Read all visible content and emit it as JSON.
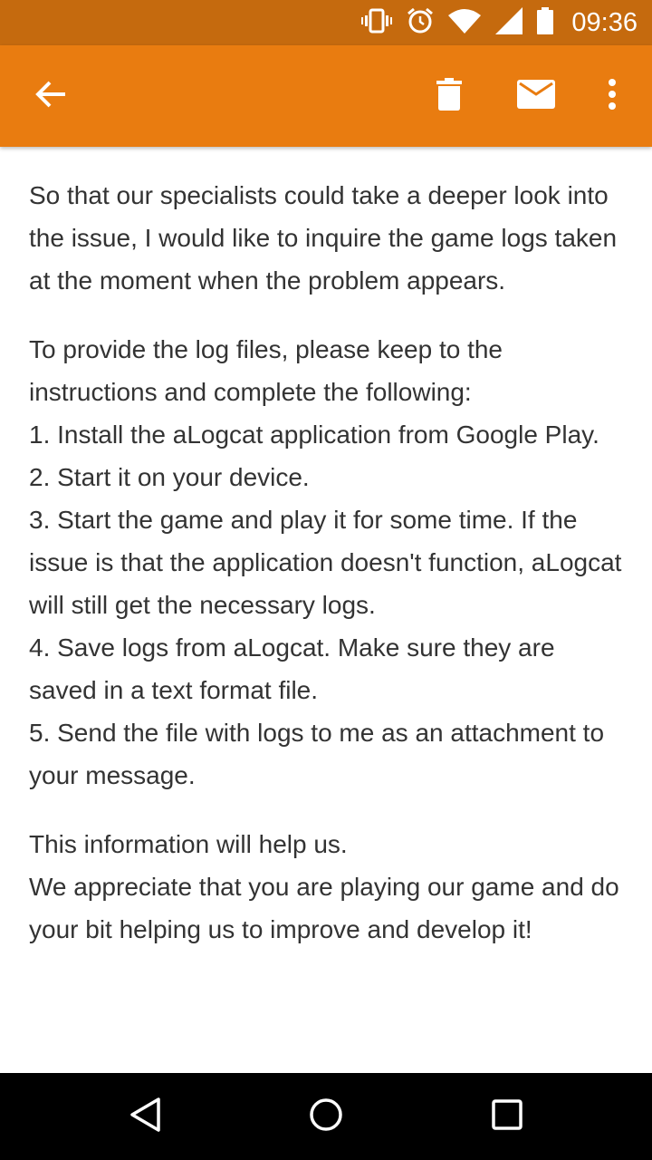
{
  "status_bar": {
    "time": "09:36",
    "icons": [
      "vibrate-icon",
      "alarm-icon",
      "wifi-icon",
      "signal-icon",
      "battery-icon"
    ]
  },
  "app_bar": {
    "background_color": "#e97c10",
    "actions": [
      "back-arrow-icon",
      "delete-icon",
      "mail-icon",
      "more-vert-icon"
    ]
  },
  "message": {
    "paragraphs": [
      {
        "lines": [
          "So that our specialists could take a deeper look into the issue, I would like to inquire the game logs taken at the moment when the problem appears."
        ]
      },
      {
        "lines": [
          "To provide the log files, please keep to the instructions and complete the following:",
          "1. Install the aLogcat application from Google Play.",
          "2. Start it on your device.",
          "3. Start the game and play it for some time. If the issue is that the application doesn't function, aLogcat will still get the necessary logs.",
          "4. Save logs from aLogcat. Make sure they are saved in a text format file.",
          "5. Send the file with logs to me as an attachment to your message."
        ]
      },
      {
        "lines": [
          "This information will help us.",
          "We appreciate that you are playing our game and do your bit helping us to improve and develop it!"
        ]
      }
    ]
  },
  "nav_bar": {
    "buttons": [
      "nav-back-icon",
      "nav-home-icon",
      "nav-recents-icon"
    ]
  }
}
